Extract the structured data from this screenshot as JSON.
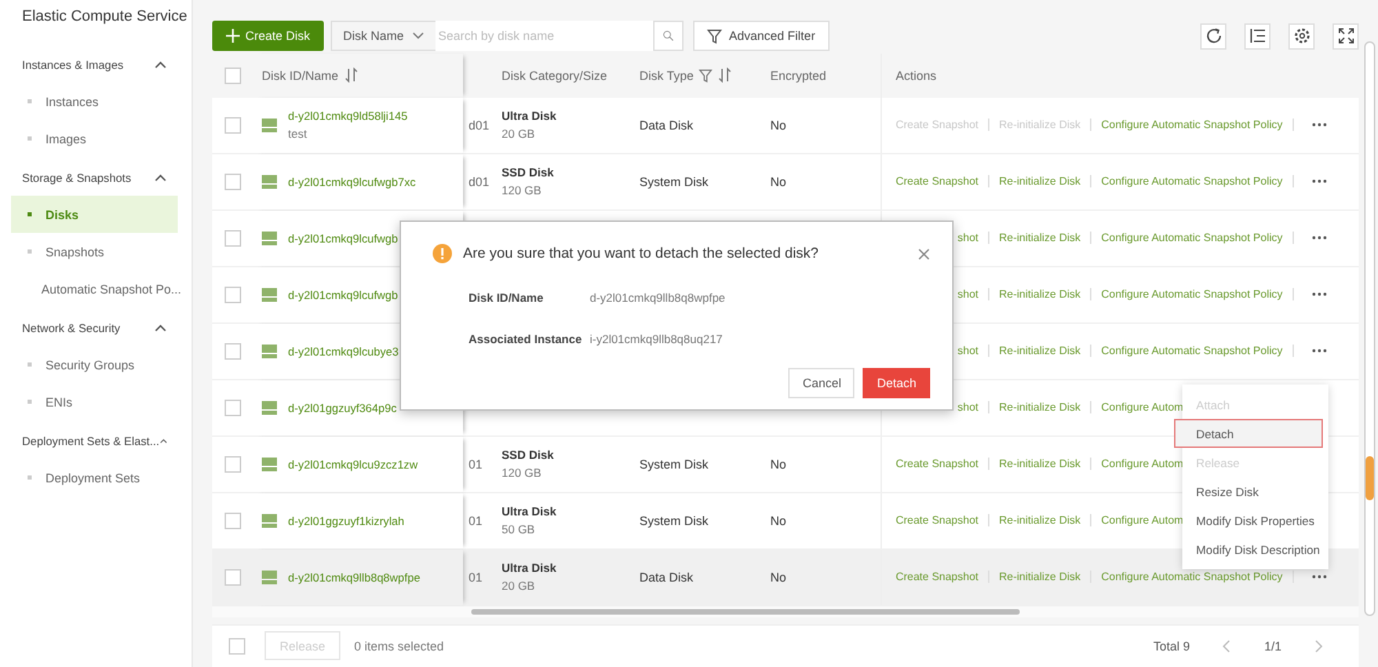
{
  "sidebar": {
    "title": "Elastic Compute Service",
    "groups": [
      {
        "label": "Instances & Images",
        "expanded": true,
        "items": [
          {
            "label": "Instances",
            "selected": false
          },
          {
            "label": "Images",
            "selected": false
          }
        ]
      },
      {
        "label": "Storage & Snapshots",
        "expanded": true,
        "items": [
          {
            "label": "Disks",
            "selected": true
          },
          {
            "label": "Snapshots",
            "selected": false
          },
          {
            "label": "Automatic Snapshot Po...",
            "selected": false
          }
        ]
      },
      {
        "label": "Network & Security",
        "expanded": true,
        "items": [
          {
            "label": "Security Groups",
            "selected": false
          },
          {
            "label": "ENIs",
            "selected": false
          }
        ]
      },
      {
        "label": "Deployment Sets & Elast...",
        "expanded": true,
        "items": [
          {
            "label": "Deployment Sets",
            "selected": false
          }
        ]
      }
    ]
  },
  "toolbar": {
    "create_button": "Create Disk",
    "search_field_select": "Disk Name",
    "search_placeholder": "Search by disk name",
    "filter_button": "Advanced Filter"
  },
  "table": {
    "select_all_checked": false,
    "columns": [
      {
        "label": "Disk ID/Name",
        "sortable": true
      },
      {
        "label": "Disk Category/Size"
      },
      {
        "label": "Disk Type",
        "sortable": true,
        "filterable": true
      },
      {
        "label": "Encrypted"
      },
      {
        "label": "Actions"
      }
    ],
    "rows": [
      {
        "id": "d-y2l01cmkq9ld58lji145",
        "name": "test",
        "column_2": "d01",
        "category": "Ultra Disk",
        "size": "20 GB",
        "type": "Data Disk",
        "encrypted": "No",
        "checked": false,
        "highlighted": false,
        "actions": [
          {
            "kind": "link",
            "label": "Create Snapshot",
            "disabled": true
          },
          {
            "kind": "link",
            "label": "Re-initialize Disk",
            "disabled": true
          },
          {
            "kind": "link",
            "label": "Configure Automatic Snapshot Policy",
            "disabled": false
          },
          {
            "kind": "more"
          }
        ]
      },
      {
        "id": "d-y2l01cmkq9lcufwgb7xc",
        "column_2": "d01",
        "category": "SSD Disk",
        "size": "120 GB",
        "type": "System Disk",
        "encrypted": "No",
        "checked": false,
        "highlighted": false,
        "actions": [
          {
            "kind": "link",
            "label": "Create Snapshot",
            "disabled": false
          },
          {
            "kind": "link",
            "label": "Re-initialize Disk",
            "disabled": false
          },
          {
            "kind": "link",
            "label": "Configure Automatic Snapshot Policy",
            "disabled": false
          },
          {
            "kind": "more"
          }
        ]
      },
      {
        "id": "d-y2l01cmkq9lcufwgb",
        "checked": false,
        "highlighted": false,
        "actions": [
          {
            "kind": "link",
            "label": "shot",
            "disabled": false
          },
          {
            "kind": "link",
            "label": "Re-initialize Disk",
            "disabled": false
          },
          {
            "kind": "link",
            "label": "Configure Automatic Snapshot Policy",
            "disabled": false
          },
          {
            "kind": "more"
          }
        ]
      },
      {
        "id": "d-y2l01cmkq9lcufwgb",
        "checked": false,
        "highlighted": false,
        "actions": [
          {
            "kind": "link",
            "label": "shot",
            "disabled": false
          },
          {
            "kind": "link",
            "label": "Re-initialize Disk",
            "disabled": false
          },
          {
            "kind": "link",
            "label": "Configure Automatic Snapshot Policy",
            "disabled": false
          },
          {
            "kind": "more"
          }
        ]
      },
      {
        "id": "d-y2l01cmkq9lcubye3",
        "checked": false,
        "highlighted": false,
        "actions": [
          {
            "kind": "link",
            "label": "shot",
            "disabled": false
          },
          {
            "kind": "link",
            "label": "Re-initialize Disk",
            "disabled": false
          },
          {
            "kind": "link",
            "label": "Configure Automatic Snapshot Policy",
            "disabled": false
          },
          {
            "kind": "more"
          }
        ]
      },
      {
        "id": "d-y2l01ggzuyf364p9c",
        "checked": false,
        "highlighted": false,
        "actions": [
          {
            "kind": "link",
            "label": "shot",
            "disabled": false
          },
          {
            "kind": "link",
            "label": "Re-initialize Disk",
            "disabled": false
          },
          {
            "kind": "link",
            "label": "Configure Autom",
            "disabled": false
          }
        ]
      },
      {
        "id": "d-y2l01cmkq9lcu9zcz1zw",
        "column_2": "01",
        "category": "SSD Disk",
        "size": "120 GB",
        "type": "System Disk",
        "encrypted": "No",
        "checked": false,
        "highlighted": false,
        "actions": [
          {
            "kind": "link",
            "label": "Create Snapshot",
            "disabled": false
          },
          {
            "kind": "link",
            "label": "Re-initialize Disk",
            "disabled": false
          },
          {
            "kind": "link",
            "label": "Configure Autom",
            "disabled": false
          }
        ]
      },
      {
        "id": "d-y2l01ggzuyf1kizrylah",
        "column_2": "01",
        "category": "Ultra Disk",
        "size": "50 GB",
        "type": "System Disk",
        "encrypted": "No",
        "checked": false,
        "highlighted": false,
        "actions": [
          {
            "kind": "link",
            "label": "Create Snapshot",
            "disabled": false
          },
          {
            "kind": "link",
            "label": "Re-initialize Disk",
            "disabled": false
          },
          {
            "kind": "link",
            "label": "Configure Autom",
            "disabled": false
          }
        ]
      },
      {
        "id": "d-y2l01cmkq9llb8q8wpfpe",
        "column_2": "01",
        "category": "Ultra Disk",
        "size": "20 GB",
        "type": "Data Disk",
        "encrypted": "No",
        "checked": false,
        "highlighted": true,
        "actions": [
          {
            "kind": "link",
            "label": "Create Snapshot",
            "disabled": false
          },
          {
            "kind": "link",
            "label": "Re-initialize Disk",
            "disabled": false
          },
          {
            "kind": "link",
            "label": "Configure Automatic Snapshot Policy",
            "disabled": false
          },
          {
            "kind": "more"
          }
        ]
      }
    ]
  },
  "footer": {
    "select_all_checked": false,
    "release_button": "Release",
    "selected_count": "0 items selected",
    "total": "Total 9",
    "page": "1/1"
  },
  "dialog": {
    "title": "Are you sure that you want to detach the selected disk?",
    "fields": [
      {
        "label": "Disk ID/Name",
        "value": "d-y2l01cmkq9llb8q8wpfpe"
      },
      {
        "label": "Associated Instance",
        "value": "i-y2l01cmkq9llb8q8uq217"
      }
    ],
    "cancel": "Cancel",
    "confirm": "Detach"
  },
  "menu": {
    "items": [
      {
        "label": "Attach",
        "disabled": true,
        "highlighted": false
      },
      {
        "label": "Detach",
        "disabled": false,
        "highlighted": true
      },
      {
        "label": "Release",
        "disabled": true,
        "highlighted": false
      },
      {
        "label": "Resize Disk",
        "disabled": false,
        "highlighted": false
      },
      {
        "label": "Modify Disk Properties",
        "disabled": false,
        "highlighted": false
      },
      {
        "label": "Modify Disk Description",
        "disabled": false,
        "highlighted": false
      }
    ]
  }
}
